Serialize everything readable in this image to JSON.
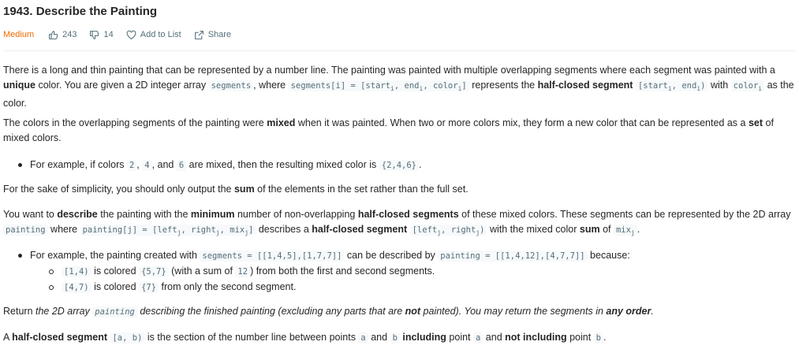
{
  "problem": {
    "title": "1943. Describe the Painting",
    "difficulty": "Medium",
    "likes": "243",
    "dislikes": "14",
    "add_to_list": "Add to List",
    "share": "Share"
  },
  "colors": {
    "difficulty": "#ef6c00",
    "text": "#262626",
    "muted": "#546e7a",
    "code_bg": "#f7f9fa"
  },
  "icons": [
    "thumbs-up-icon",
    "thumbs-down-icon",
    "heart-icon",
    "share-icon"
  ],
  "text": {
    "p1_a": "There is a long and thin painting that can be represented by a number line. The painting was painted with multiple overlapping segments where each segment was painted with a",
    "p1_unique": "unique",
    "p1_b": " color. You are given a 2D integer array ",
    "p1_code1": "segments",
    "p1_c": ", where ",
    "p1_code2": "segments[i] = [start",
    "p1_d": " represents the ",
    "p1_bold2": "half-closed segment",
    "p1_e": " with ",
    "p1_f": " as the",
    "p1_g": "color.",
    "p2_a": "The colors in the overlapping segments of the painting were ",
    "p2_mixed": "mixed",
    "p2_b": " when it was painted. When two or more colors mix, they form a new color that can be represented as a ",
    "p2_set": "set",
    "p2_c": " of",
    "p2_d": "mixed colors.",
    "li1_a": "For example, if colors ",
    "li1_c2": "2",
    "li1_c4": "4",
    "li1_c6": "6",
    "li1_b": ", and ",
    "li1_c": " are mixed, then the resulting mixed color is ",
    "li1_set": "{2,4,6}",
    "p3_a": "For the sake of simplicity, you should only output the ",
    "p3_sum": "sum",
    "p3_b": " of the elements in the set rather than the full set.",
    "p4_a": "You want to ",
    "p4_describe": "describe",
    "p4_b": " the painting with the ",
    "p4_minimum": "minimum",
    "p4_c": " number of non-overlapping ",
    "p4_hcs": "half-closed segments",
    "p4_d": " of these mixed colors. These segments can be represented by the 2D array",
    "p4_painting": "painting",
    "p4_e": " where ",
    "p4_pj": "painting[j] = [left",
    "p4_f": " describes a ",
    "p4_g": " with the mixed color ",
    "p4_sum": "sum",
    "p4_h": " of ",
    "li2_a": "For example, the painting created with ",
    "li2_code1": "segments = [[1,4,5],[1,7,7]]",
    "li2_b": " can be described by ",
    "li2_code2": "painting = [[1,4,12],[4,7,7]]",
    "li2_c": " because:",
    "sub1_code": "[1,4)",
    "sub1_a": " is colored ",
    "sub1_set": "{5,7}",
    "sub1_b": " (with a sum of ",
    "sub1_sum": "12",
    "sub1_c": ") from both the first and second segments.",
    "sub2_code": "[4,7)",
    "sub2_a": " is colored ",
    "sub2_set": "{7}",
    "sub2_b": " from only the second segment.",
    "p5_a": "Return ",
    "p5_b": "the 2D array ",
    "p5_code": "painting",
    "p5_c": " describing the finished painting (excluding any parts that are ",
    "p5_not": "not",
    "p5_d": " painted). You may return the segments in ",
    "p5_any": "any order",
    "p6_a": "A ",
    "p6_hcs": "half-closed segment",
    "p6_code": "[a, b)",
    "p6_b": " is the section of the number line between points ",
    "p6_ca": "a",
    "p6_and": " and ",
    "p6_cb": "b",
    "p6_incl": "including",
    "p6_c": " point ",
    "p6_d": " and ",
    "p6_notincl": "not including",
    "p6_e": " point "
  }
}
